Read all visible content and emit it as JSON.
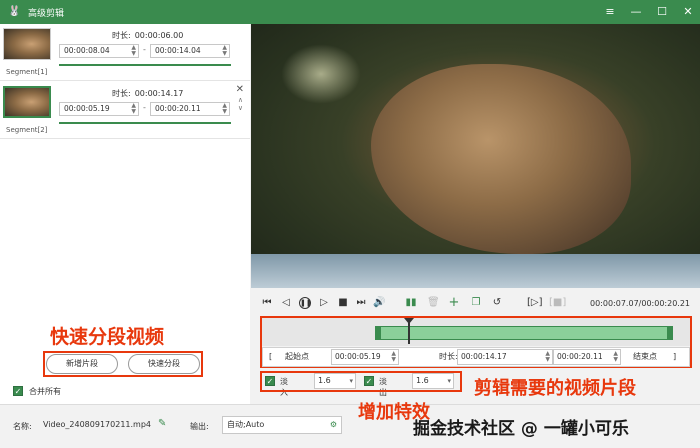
{
  "window": {
    "title": "高级剪辑",
    "controls": [
      "≡",
      "—",
      "☐",
      "✕"
    ]
  },
  "segments": [
    {
      "label": "Segment[1]",
      "duration_label": "时长:",
      "duration": "00:00:06.00",
      "start": "00:00:08.04",
      "end": "00:00:14.04"
    },
    {
      "label": "Segment[2]",
      "duration_label": "时长:",
      "duration": "00:00:14.17",
      "start": "00:00:05.19",
      "end": "00:00:20.11"
    }
  ],
  "annotations": {
    "quick_split": "快速分段视频",
    "clip_needed": "剪辑需要的视频片段",
    "add_effects": "增加特效"
  },
  "buttons": {
    "add_segment": "新增片段",
    "quick_split": "快速分段",
    "merge_all": "合并所有"
  },
  "player": {
    "time_readout": "00:00:07.07/00:00:20.21"
  },
  "trim": {
    "start_label": "起始点",
    "start_value": "00:00:05.19",
    "duration_label": "时长:",
    "duration_value": "00:00:14.17",
    "end_value": "00:00:20.11",
    "end_label": "结束点"
  },
  "effects": {
    "fade_in_label": "淡入",
    "fade_in_value": "1.6",
    "fade_out_label": "淡出",
    "fade_out_value": "1.6"
  },
  "footer": {
    "name_label": "名称:",
    "name_value": "Video_240809170211.mp4",
    "output_label": "输出:",
    "output_value": "自动;Auto",
    "watermark": "掘金技术社区 @ 一罐小可乐"
  },
  "colors": {
    "accent": "#3a8b4e",
    "annotation": "#e8380d"
  }
}
